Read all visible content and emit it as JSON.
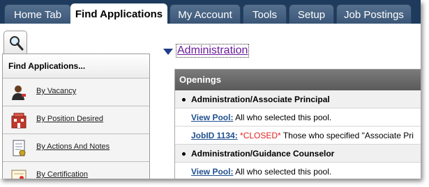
{
  "tabs": [
    {
      "label": "Home Tab",
      "active": false
    },
    {
      "label": "Find Applications",
      "active": true
    },
    {
      "label": "My Account",
      "active": false
    },
    {
      "label": "Tools",
      "active": false
    },
    {
      "label": "Setup",
      "active": false
    },
    {
      "label": "Job Postings",
      "active": false
    }
  ],
  "sidebar": {
    "search_icon": "magnifier-icon",
    "header": "Find Applications...",
    "items": [
      {
        "label": "By Vacancy",
        "icon": "person-icon"
      },
      {
        "label": "By Position Desired",
        "icon": "building-icon"
      },
      {
        "label": "By Actions And Notes",
        "icon": "notes-icon"
      },
      {
        "label": "By Certification",
        "icon": "certificate-icon"
      }
    ]
  },
  "main": {
    "section_title": "Administration",
    "openings_header": "Openings",
    "rows": [
      {
        "type": "category",
        "text": "Administration/Associate Principal"
      },
      {
        "type": "item",
        "link": "View Pool:",
        "text": " All who selected this pool."
      },
      {
        "type": "item",
        "link": "JobID 1134:",
        "closed": " *CLOSED*",
        "text": " Those who specified \"Associate Pri"
      },
      {
        "type": "category",
        "text": "Administration/Guidance Counselor"
      },
      {
        "type": "item",
        "link": "View Pool:",
        "text": " All who selected this pool."
      }
    ]
  },
  "colors": {
    "tabbar": "#1e3a5c",
    "link": "#1f4f8f",
    "visited_link": "#6a1b9a",
    "closed": "#e02020",
    "openings_header": "#666666"
  }
}
